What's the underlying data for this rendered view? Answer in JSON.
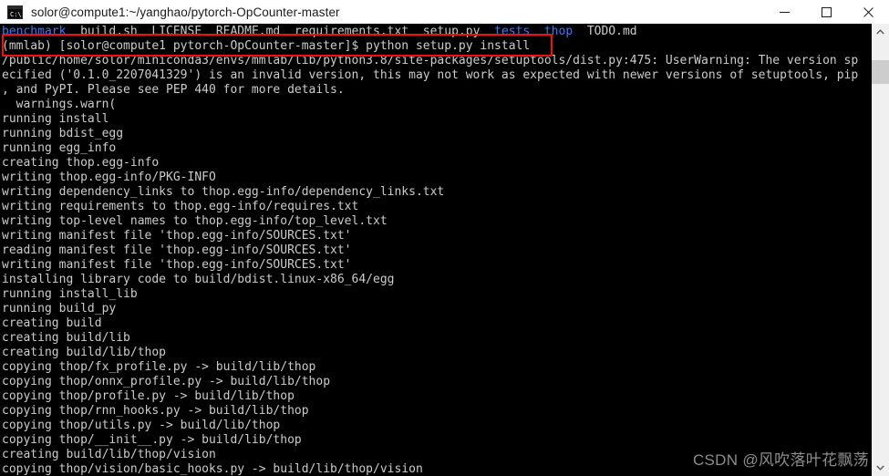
{
  "window": {
    "title": "solor@compute1:~/yanghao/pytorch-OpCounter-master",
    "icon_name": "console-icon",
    "minimize_label": "Minimize",
    "maximize_label": "Maximize",
    "close_label": "Close"
  },
  "terminal": {
    "background_color": "#000000",
    "foreground_color": "#cccccc",
    "directory_color": "#3b78ff",
    "lines": [
      {
        "id": "line-file-listing",
        "segments": [
          {
            "text": "benchmark",
            "color": "dir"
          },
          {
            "text": "  build.sh  LICENSE  README.md  requirements.txt  setup.py  ",
            "color": "white"
          },
          {
            "text": "tests",
            "color": "dir"
          },
          {
            "text": "  ",
            "color": "white"
          },
          {
            "text": "thop",
            "color": "dir"
          },
          {
            "text": "  TODO.md",
            "color": "white"
          }
        ]
      },
      {
        "id": "line-prompt-command",
        "segments": [
          {
            "text": "(mmlab) [solor@compute1 pytorch-OpCounter-master]$ python setup.py install",
            "color": "white"
          }
        ]
      },
      {
        "id": "line-warning-path",
        "segments": [
          {
            "text": "/public/home/solor/miniconda3/envs/mmlab/lib/python3.8/site-packages/setuptools/dist.py:475: UserWarning: The version sp",
            "color": "white"
          }
        ]
      },
      {
        "id": "line-warning-cont-1",
        "segments": [
          {
            "text": "ecified ('0.1.0_2207041329') is an invalid version, this may not work as expected with newer versions of setuptools, pip",
            "color": "white"
          }
        ]
      },
      {
        "id": "line-warning-cont-2",
        "segments": [
          {
            "text": ", and PyPI. Please see PEP 440 for more details.",
            "color": "white"
          }
        ]
      },
      {
        "id": "line-warnings-warn",
        "segments": [
          {
            "text": "  warnings.warn(",
            "color": "white"
          }
        ]
      },
      {
        "id": "line-running-install",
        "segments": [
          {
            "text": "running install",
            "color": "white"
          }
        ]
      },
      {
        "id": "line-running-bdist-egg",
        "segments": [
          {
            "text": "running bdist_egg",
            "color": "white"
          }
        ]
      },
      {
        "id": "line-running-egg-info",
        "segments": [
          {
            "text": "running egg_info",
            "color": "white"
          }
        ]
      },
      {
        "id": "line-creating-egg-info",
        "segments": [
          {
            "text": "creating thop.egg-info",
            "color": "white"
          }
        ]
      },
      {
        "id": "line-writing-pkg-info",
        "segments": [
          {
            "text": "writing thop.egg-info/PKG-INFO",
            "color": "white"
          }
        ]
      },
      {
        "id": "line-writing-dependency-links",
        "segments": [
          {
            "text": "writing dependency_links to thop.egg-info/dependency_links.txt",
            "color": "white"
          }
        ]
      },
      {
        "id": "line-writing-requirements",
        "segments": [
          {
            "text": "writing requirements to thop.egg-info/requires.txt",
            "color": "white"
          }
        ]
      },
      {
        "id": "line-writing-top-level",
        "segments": [
          {
            "text": "writing top-level names to thop.egg-info/top_level.txt",
            "color": "white"
          }
        ]
      },
      {
        "id": "line-writing-manifest-1",
        "segments": [
          {
            "text": "writing manifest file 'thop.egg-info/SOURCES.txt'",
            "color": "white"
          }
        ]
      },
      {
        "id": "line-reading-manifest",
        "segments": [
          {
            "text": "reading manifest file 'thop.egg-info/SOURCES.txt'",
            "color": "white"
          }
        ]
      },
      {
        "id": "line-writing-manifest-2",
        "segments": [
          {
            "text": "writing manifest file 'thop.egg-info/SOURCES.txt'",
            "color": "white"
          }
        ]
      },
      {
        "id": "line-installing-library-code",
        "segments": [
          {
            "text": "installing library code to build/bdist.linux-x86_64/egg",
            "color": "white"
          }
        ]
      },
      {
        "id": "line-running-install-lib",
        "segments": [
          {
            "text": "running install_lib",
            "color": "white"
          }
        ]
      },
      {
        "id": "line-running-build-py",
        "segments": [
          {
            "text": "running build_py",
            "color": "white"
          }
        ]
      },
      {
        "id": "line-creating-build",
        "segments": [
          {
            "text": "creating build",
            "color": "white"
          }
        ]
      },
      {
        "id": "line-creating-build-lib",
        "segments": [
          {
            "text": "creating build/lib",
            "color": "white"
          }
        ]
      },
      {
        "id": "line-creating-build-lib-thop",
        "segments": [
          {
            "text": "creating build/lib/thop",
            "color": "white"
          }
        ]
      },
      {
        "id": "line-copying-fx-profile",
        "segments": [
          {
            "text": "copying thop/fx_profile.py -> build/lib/thop",
            "color": "white"
          }
        ]
      },
      {
        "id": "line-copying-onnx-profile",
        "segments": [
          {
            "text": "copying thop/onnx_profile.py -> build/lib/thop",
            "color": "white"
          }
        ]
      },
      {
        "id": "line-copying-profile",
        "segments": [
          {
            "text": "copying thop/profile.py -> build/lib/thop",
            "color": "white"
          }
        ]
      },
      {
        "id": "line-copying-rnn-hooks",
        "segments": [
          {
            "text": "copying thop/rnn_hooks.py -> build/lib/thop",
            "color": "white"
          }
        ]
      },
      {
        "id": "line-copying-utils",
        "segments": [
          {
            "text": "copying thop/utils.py -> build/lib/thop",
            "color": "white"
          }
        ]
      },
      {
        "id": "line-copying-init",
        "segments": [
          {
            "text": "copying thop/__init__.py -> build/lib/thop",
            "color": "white"
          }
        ]
      },
      {
        "id": "line-creating-build-lib-thop-vision",
        "segments": [
          {
            "text": "creating build/lib/thop/vision",
            "color": "white"
          }
        ]
      },
      {
        "id": "line-copying-basic-hooks",
        "segments": [
          {
            "text": "copying thop/vision/basic_hooks.py -> build/lib/thop/vision",
            "color": "white"
          }
        ]
      }
    ]
  },
  "annotation": {
    "color": "#ee1111",
    "highlighted_text": "(mmlab) [solor@compute1 pytorch-OpCounter-master]$ python setup.py install"
  },
  "watermark": {
    "text": "CSDN @风吹落叶花飘荡"
  },
  "scrollbar": {
    "up_arrow_name": "scroll-up-arrow",
    "down_arrow_name": "scroll-down-arrow"
  }
}
